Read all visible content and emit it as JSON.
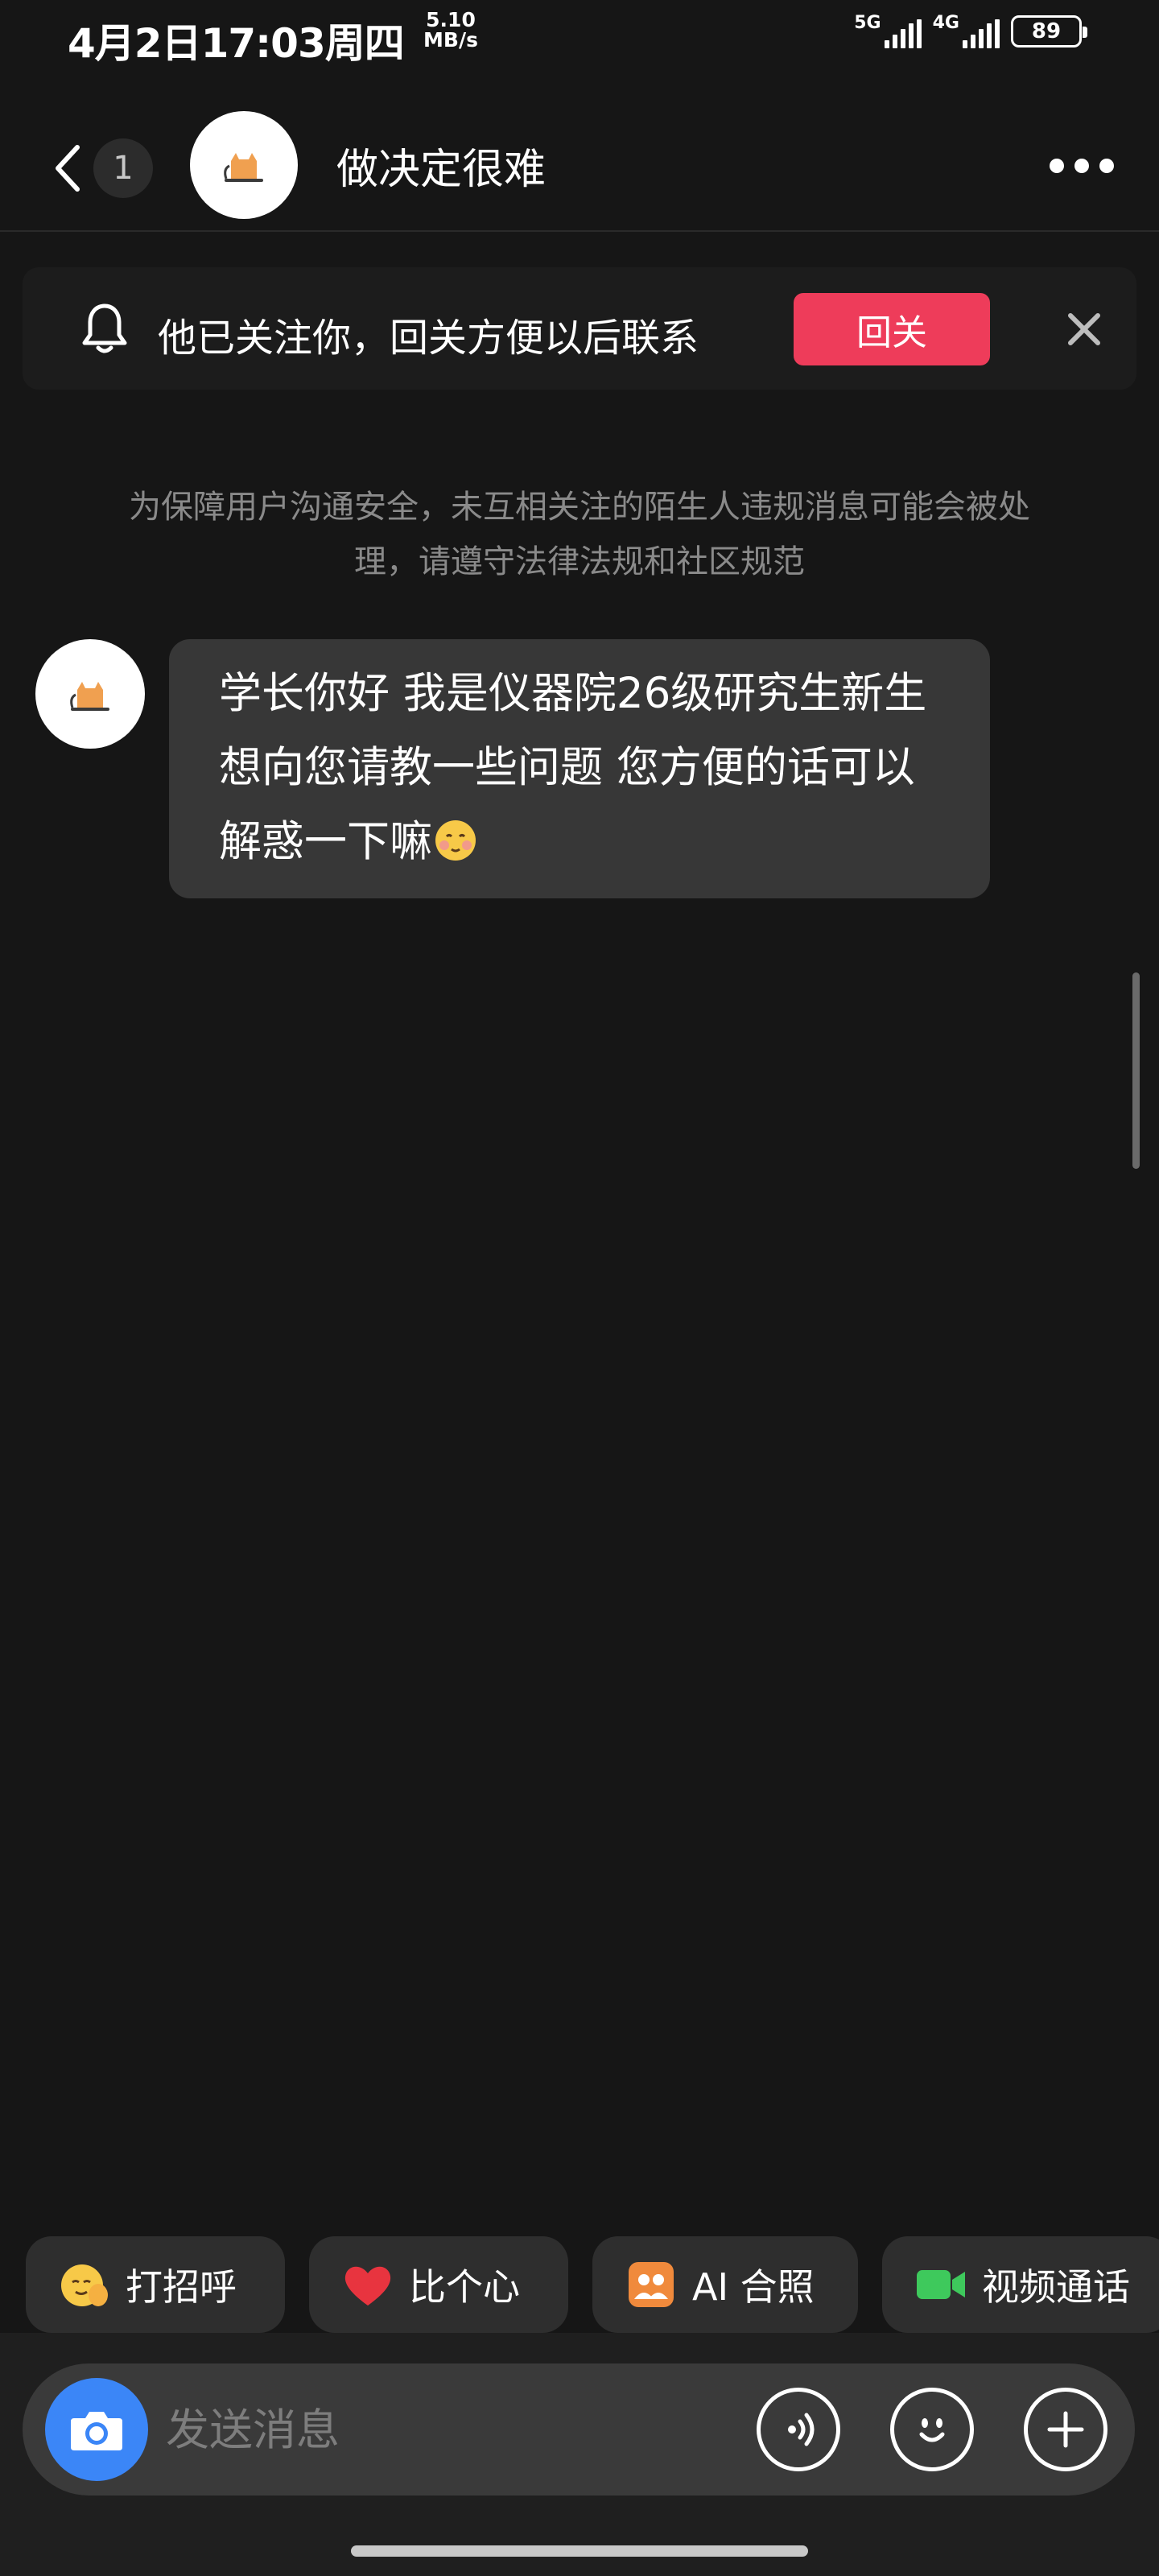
{
  "status_bar": {
    "time": "4月2日17:03周四",
    "speed_value": "5.10",
    "speed_unit": "MB/s",
    "network_1": "5G",
    "network_2": "4G",
    "battery": "89"
  },
  "header": {
    "unread_count": "1",
    "title": "做决定很难"
  },
  "follow_banner": {
    "text": "他已关注你，回关方便以后联系",
    "button_label": "回关"
  },
  "notice": "为保障用户沟通安全，未互相关注的陌生人违规消息可能会被处理，请遵守法律法规和社区规范",
  "messages": [
    {
      "text": "学长你好 我是仪器院26级研究生新生 想向您请教一些问题 您方便的话可以解惑一下嘛",
      "emoji": "shy-face-emoji"
    }
  ],
  "quick_actions": [
    {
      "label": "打招呼",
      "icon": "wave-emoji-icon"
    },
    {
      "label": "比个心",
      "icon": "heart-icon"
    },
    {
      "label": "AI 合照",
      "icon": "ai-photo-icon"
    },
    {
      "label": "视频通话",
      "icon": "video-camera-icon"
    }
  ],
  "input": {
    "placeholder": "发送消息"
  },
  "colors": {
    "background": "#161616",
    "follow_button": "#ee3c5a",
    "camera_button": "#3b86f7",
    "bubble": "#373737",
    "heart": "#e8343f",
    "video": "#3ec95c",
    "ai_photo": "#f08a3c"
  }
}
